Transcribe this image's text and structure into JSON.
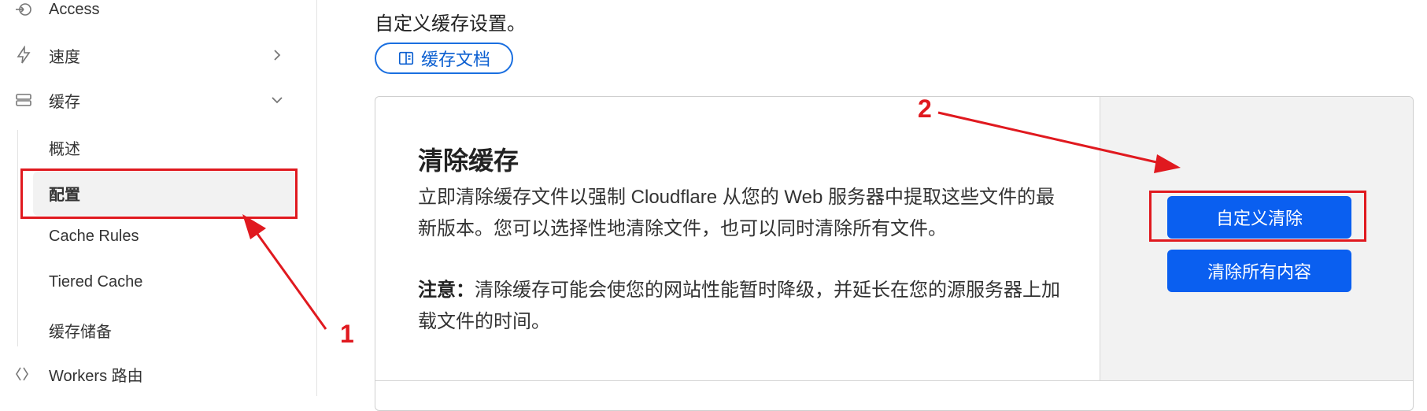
{
  "sidebar": {
    "items": [
      {
        "label": "Access",
        "icon": "access-icon"
      },
      {
        "label": "速度",
        "icon": "lightning-icon"
      },
      {
        "label": "缓存",
        "icon": "storage-icon"
      },
      {
        "label": "Workers 路由",
        "icon": "workers-icon"
      }
    ],
    "cache_sub": [
      "概述",
      "配置",
      "Cache Rules",
      "Tiered Cache",
      "缓存储备"
    ]
  },
  "main": {
    "intro": "自定义缓存设置。",
    "doc_button": "缓存文档"
  },
  "card": {
    "title": "清除缓存",
    "desc": "立即清除缓存文件以强制 Cloudflare 从您的 Web 服务器中提取这些文件的最新版本。您可以选择性地清除文件，也可以同时清除所有文件。",
    "note_label": "注意：",
    "note_text": "清除缓存可能会使您的网站性能暂时降级，并延长在您的源服务器上加载文件的时间。",
    "custom_purge": "自定义清除",
    "purge_all": "清除所有内容"
  },
  "annotations": {
    "one": "1",
    "two": "2",
    "color": "#e0191f"
  },
  "colors": {
    "primary": "#0a5ff0",
    "link": "#0b5fd1"
  }
}
